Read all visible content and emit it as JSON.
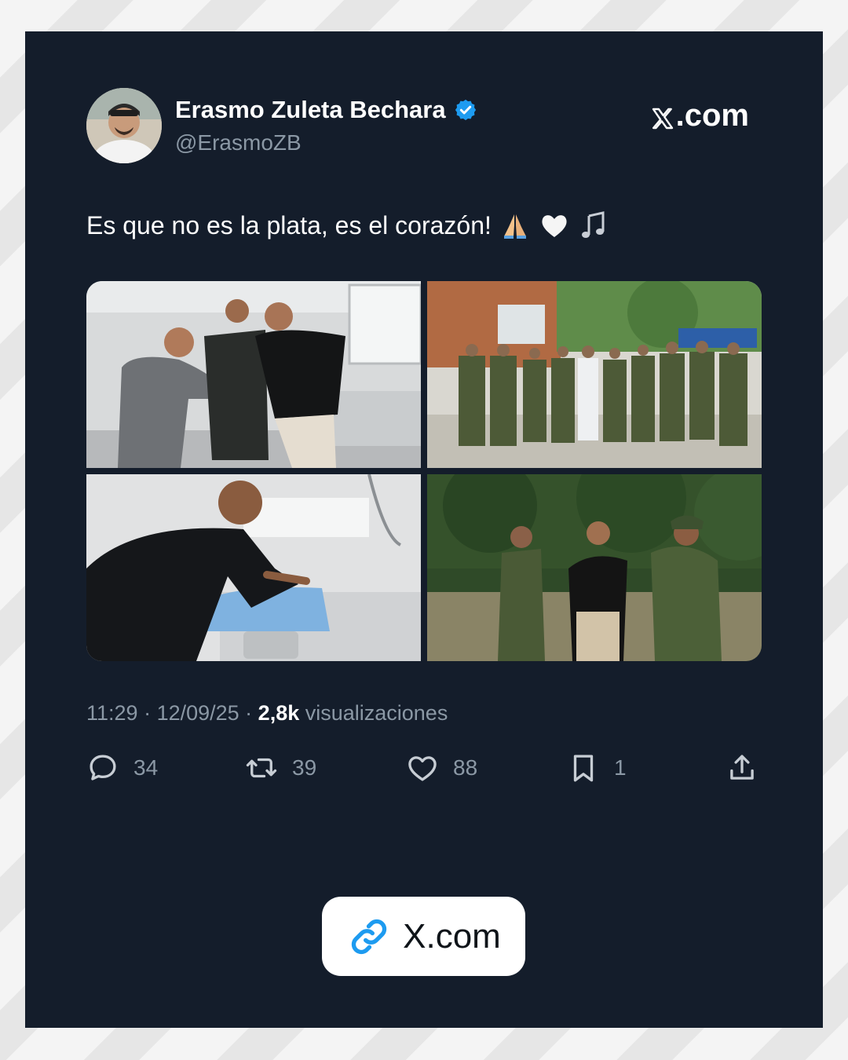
{
  "header": {
    "author_name": "Erasmo Zuleta Bechara",
    "author_handle": "@ErasmoZB",
    "brand": ".com",
    "verified": true
  },
  "tweet": {
    "text": "Es que no es la plata, es el corazón!",
    "emojis": [
      "folded-hands-emoji",
      "white-heart-emoji",
      "musical-notes-emoji"
    ],
    "media": [
      {
        "name": "photo-hospital-handshake",
        "description_icon": "photo"
      },
      {
        "name": "photo-police-group",
        "description_icon": "photo"
      },
      {
        "name": "photo-hospital-bedside",
        "description_icon": "photo"
      },
      {
        "name": "photo-army-walk",
        "description_icon": "photo"
      }
    ]
  },
  "meta": {
    "time": "11:29",
    "sep1": " · ",
    "date": "12/09/25",
    "sep2": " · ",
    "views_count": "2,8k",
    "views_label": " visualizaciones"
  },
  "actions": {
    "replies": "34",
    "retweets": "39",
    "likes": "88",
    "bookmarks": "1"
  },
  "link_button": {
    "label": "X.com",
    "icon": "link-icon"
  },
  "colors": {
    "card_bg": "#141d2b",
    "text_primary": "#ffffff",
    "text_secondary": "#8b98a5",
    "verified_blue": "#1d9bf0",
    "link_blue": "#1d9bf0"
  }
}
